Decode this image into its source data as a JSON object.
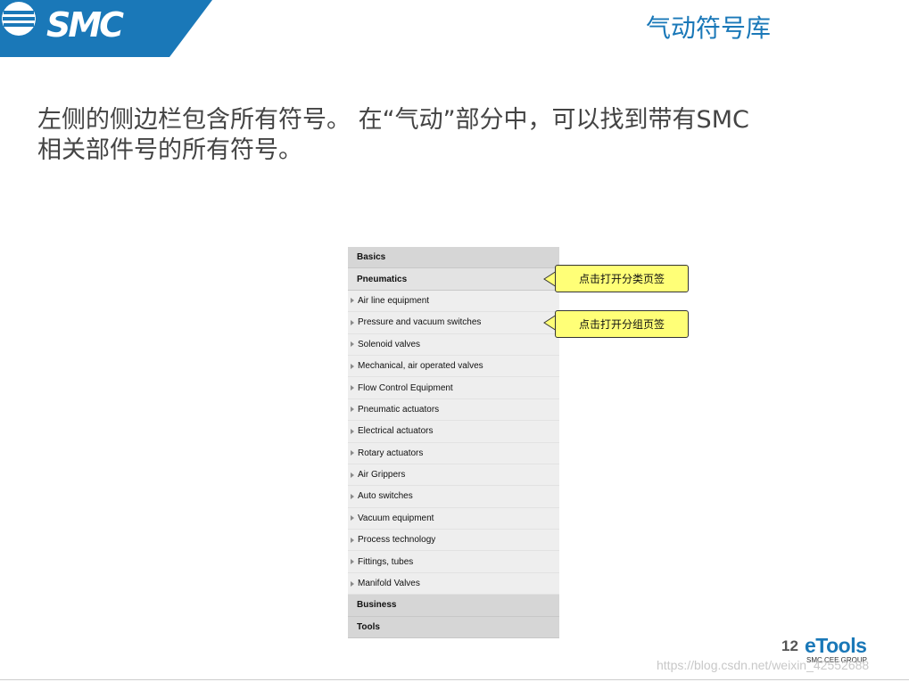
{
  "header": {
    "logo_text": "SMC",
    "slide_title": "气动符号库",
    "brand_color": "#1a78b8"
  },
  "intro": {
    "line1": "左侧的侧边栏包含所有符号。 在“气动”部分中，可以找到带有SMC",
    "line2": "相关部件号的所有符号。"
  },
  "sidebar": {
    "sections": [
      {
        "label": "Basics",
        "active": false
      },
      {
        "label": "Pneumatics",
        "active": true
      }
    ],
    "items": [
      "Air line equipment",
      "Pressure and vacuum switches",
      "Solenoid valves",
      "Mechanical, air operated valves",
      "Flow Control Equipment",
      "Pneumatic actuators",
      "Electrical actuators",
      "Rotary actuators",
      "Air Grippers",
      "Auto switches",
      "Vacuum equipment",
      "Process technology",
      "Fittings, tubes",
      "Manifold Valves"
    ],
    "footer_sections": [
      "Business",
      "Tools"
    ]
  },
  "callouts": {
    "category": "点击打开分类页签",
    "group": "点击打开分组页签",
    "fill_color": "#ffff77"
  },
  "footer": {
    "page_number": "12",
    "brand": "eTools",
    "group": "SMC CEE GROUP",
    "watermark": "https://blog.csdn.net/weixin_42552688"
  }
}
